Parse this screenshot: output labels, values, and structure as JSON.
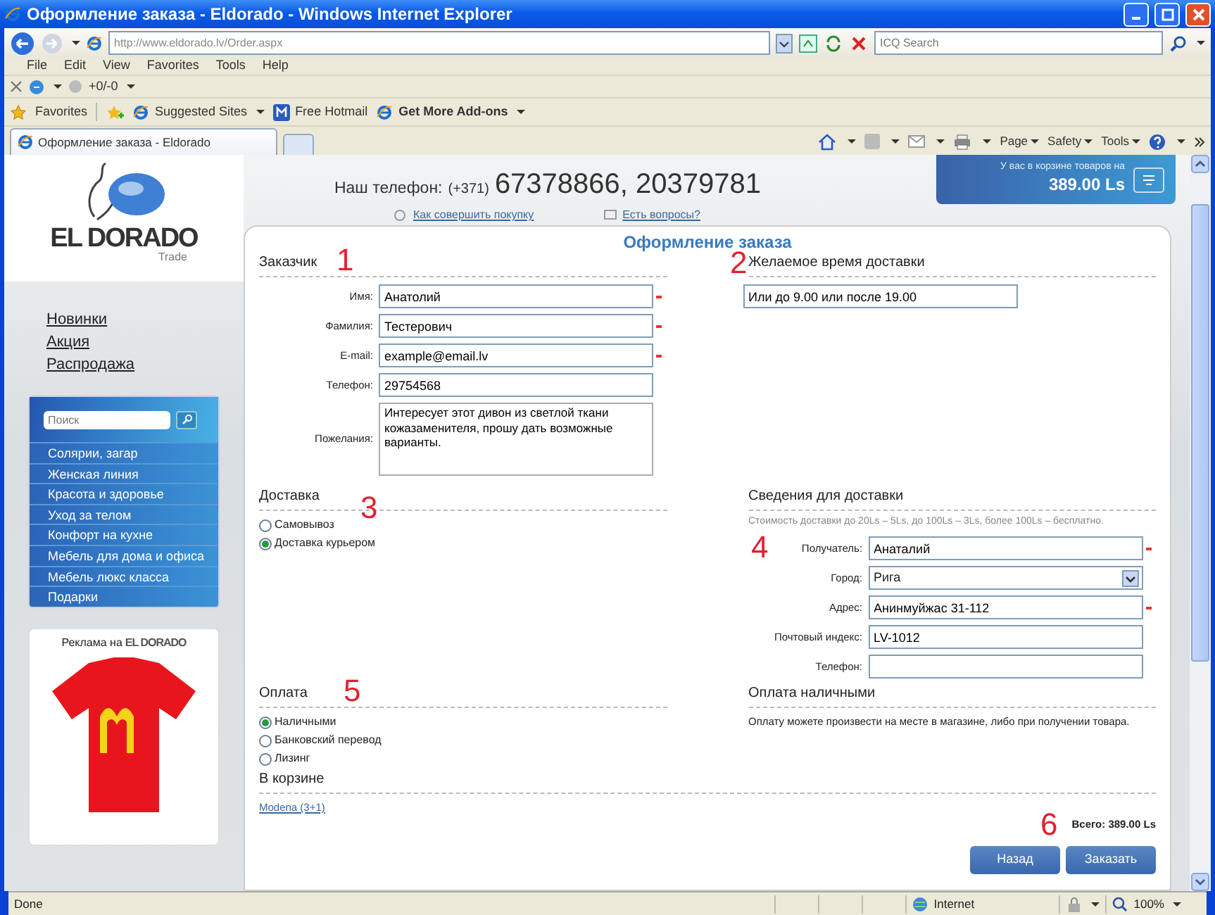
{
  "window": {
    "title": "Оформление заказа - Eldorado - Windows Internet Explorer"
  },
  "browser": {
    "address": "http://www.eldorado.lv/Order.aspx",
    "search_placeholder": "ICQ Search",
    "menu": [
      "File",
      "Edit",
      "View",
      "Favorites",
      "Tools",
      "Help"
    ],
    "toolbar_text": "+0/-0",
    "favorites_button": "Favorites",
    "favorite_links": [
      {
        "label": "Suggested Sites",
        "emphasized": false,
        "dropdown": true
      },
      {
        "label": "Free Hotmail",
        "emphasized": false,
        "dropdown": false
      },
      {
        "label": "Get More Add-ons",
        "emphasized": true,
        "dropdown": true
      }
    ],
    "tab": "Оформление заказа - Eldorado",
    "command_menus": [
      "Page",
      "Safety",
      "Tools"
    ]
  },
  "sidebar": {
    "logo": "EL DORADO",
    "logo_sub": "Trade",
    "links": [
      "Новинки",
      "Акция",
      "Распродажа"
    ],
    "search_placeholder": "Поиск",
    "categories": [
      "Солярии, загар",
      "Женская линия",
      "Красота и здоровье",
      "Уход за телом",
      "Конфорт на кухне",
      "Мебель для дома и офиса",
      "Мебель люкс класса",
      "Подарки"
    ],
    "ad": {
      "caption": "Реклама на",
      "brand": "EL DORADO"
    }
  },
  "header": {
    "phone_label": "Наш телефон:",
    "phone_code": "(+371)",
    "phone_numbers": "67378866, 20379781",
    "links": [
      "Как совершить покупку",
      "Есть вопросы?"
    ],
    "cart": {
      "caption": "У вас в корзине товаров на",
      "total": "389.00 Ls"
    }
  },
  "form": {
    "title": "Оформление заказа",
    "customer": {
      "heading": "Заказчик",
      "marker": "1",
      "fields": [
        {
          "kind": "text",
          "label": "Имя:",
          "value": "Анатолий",
          "required": true
        },
        {
          "kind": "text",
          "label": "Фамилия:",
          "value": "Тестерович",
          "required": true
        },
        {
          "kind": "text",
          "label": "E-mail:",
          "value": "example@email.lv",
          "required": true
        },
        {
          "kind": "text",
          "label": "Телефон:",
          "value": "29754568",
          "required": false
        },
        {
          "kind": "textarea",
          "label": "Пожелания:",
          "value": "Интересует этот дивон из светлой ткани кожазаменителя, прошу дать возможные варианты.",
          "required": false
        }
      ]
    },
    "delivery_time": {
      "heading": "Желаемое время доставки",
      "marker": "2",
      "value": "Или до 9.00 или после 19.00"
    },
    "delivery": {
      "heading": "Доставка",
      "marker": "3",
      "options": [
        {
          "label": "Самовывоз",
          "selected": false
        },
        {
          "label": "Доставка курьером",
          "selected": true
        }
      ]
    },
    "delivery_info": {
      "heading": "Сведения для доставки",
      "marker": "4",
      "note": "Стоимость доставки до 20Ls – 5Ls, до 100Ls – 3Ls, более 100Ls – бесплатно.",
      "fields": [
        {
          "kind": "text",
          "label": "Получатель:",
          "value": "Анаталий",
          "required": true
        },
        {
          "kind": "select",
          "label": "Город:",
          "value": "Рига",
          "required": false
        },
        {
          "kind": "text",
          "label": "Адрес:",
          "value": "Анинмуйжас 31-112",
          "required": true
        },
        {
          "kind": "text",
          "label": "Почтовый индекс:",
          "value": "LV-1012",
          "required": false
        },
        {
          "kind": "text",
          "label": "Телефон:",
          "required": false
        }
      ]
    },
    "payment": {
      "heading": "Оплата",
      "marker": "5",
      "options": [
        {
          "label": "Наличными",
          "selected": true
        },
        {
          "label": "Банковский перевод",
          "selected": false
        },
        {
          "label": "Лизинг",
          "selected": false
        }
      ]
    },
    "payment_info": {
      "heading": "Оплата наличными",
      "text": "Оплату можете произвести на месте в магазине, либо при получении товара."
    },
    "cart": {
      "heading": "В корзине",
      "item": "Modena (3+1)",
      "marker": "6",
      "total": "Всего: 389.00 Ls"
    },
    "buttons": [
      "Назад",
      "Заказать"
    ]
  },
  "status_bar": {
    "text": "Done",
    "zone": "Internet",
    "zoom": "100%"
  }
}
